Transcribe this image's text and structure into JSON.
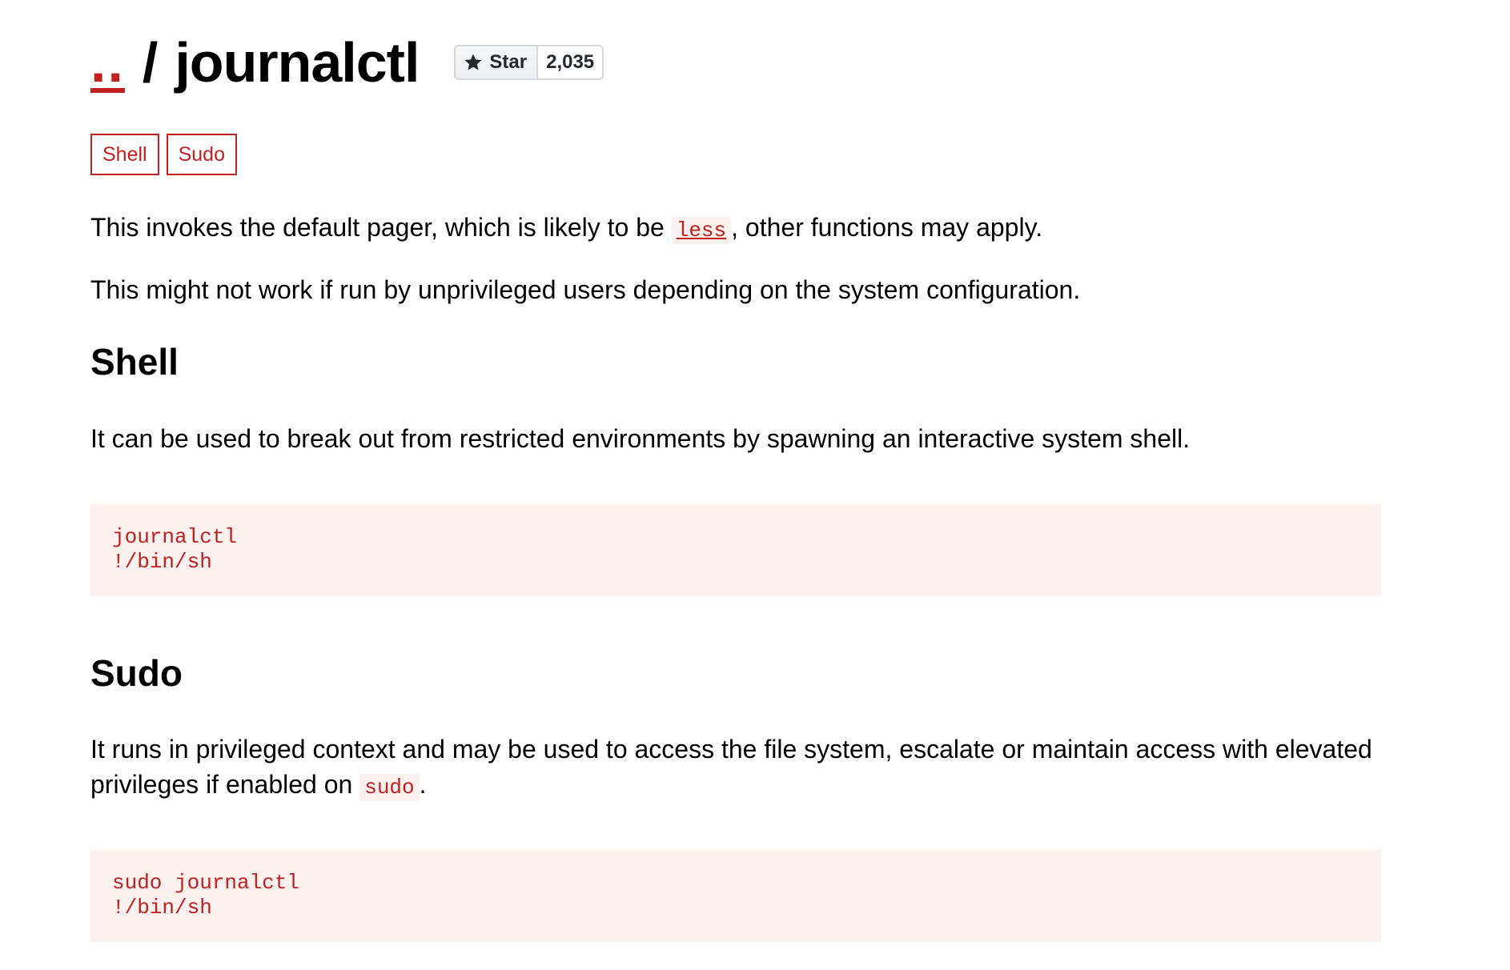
{
  "header": {
    "parent_link": "..",
    "separator": "/",
    "title": "journalctl",
    "star_label": "Star",
    "star_count": "2,035"
  },
  "tags": [
    "Shell",
    "Sudo"
  ],
  "intro": {
    "p1_before": "This invokes the default pager, which is likely to be",
    "p1_code": "less",
    "p1_after": ", other functions may apply.",
    "p2": "This might not work if run by unprivileged users depending on the system configuration."
  },
  "sections": {
    "shell": {
      "heading": "Shell",
      "description": "It can be used to break out from restricted environments by spawning an interactive system shell.",
      "code_lines": [
        "journalctl",
        "!/bin/sh"
      ]
    },
    "sudo": {
      "heading": "Sudo",
      "description_before": "It runs in privileged context and may be used to access the file system, escalate or maintain access with elevated privileges if enabled on",
      "description_code": "sudo",
      "description_after": ".",
      "code_lines": [
        "sudo journalctl",
        "!/bin/sh"
      ]
    }
  },
  "colors": {
    "accent": "#c0211f",
    "code_background": "#fdf1f0"
  }
}
